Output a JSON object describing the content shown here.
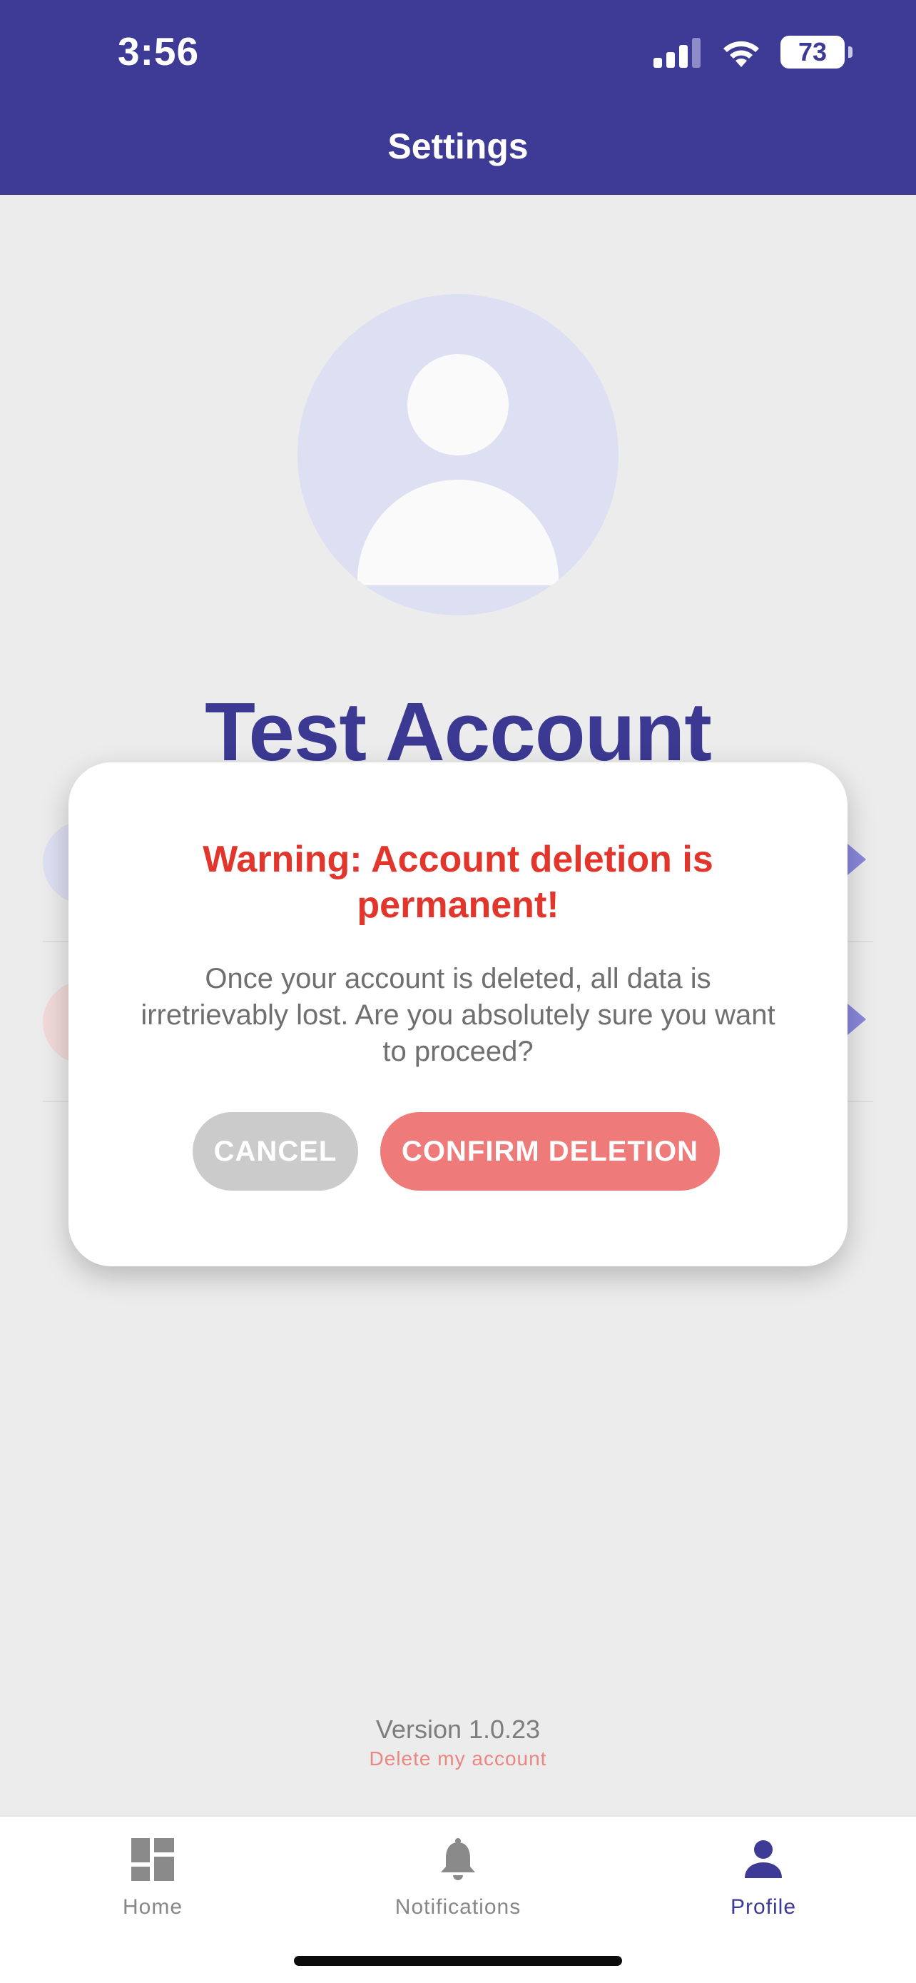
{
  "status_bar": {
    "time": "3:56",
    "battery": "73"
  },
  "header": {
    "title": "Settings"
  },
  "profile": {
    "name": "Test Account"
  },
  "modal": {
    "title": "Warning: Account deletion is permanent!",
    "body": "Once your account is deleted, all data is irretrievably lost. Are you absolutely sure you want to proceed?",
    "cancel_label": "CANCEL",
    "confirm_label": "CONFIRM DELETION"
  },
  "footer": {
    "version": "Version 1.0.23",
    "delete_link": "Delete my account"
  },
  "tabs": [
    {
      "label": "Home",
      "icon": "dashboard-icon"
    },
    {
      "label": "Notifications",
      "icon": "bell-icon"
    },
    {
      "label": "Profile",
      "icon": "person-icon",
      "active": true
    }
  ],
  "colors": {
    "primary": "#3d3b95",
    "danger": "#e2352c",
    "confirm_button": "#ee7b79",
    "cancel_button": "#cbcbcb",
    "background": "#f1f1f1"
  }
}
